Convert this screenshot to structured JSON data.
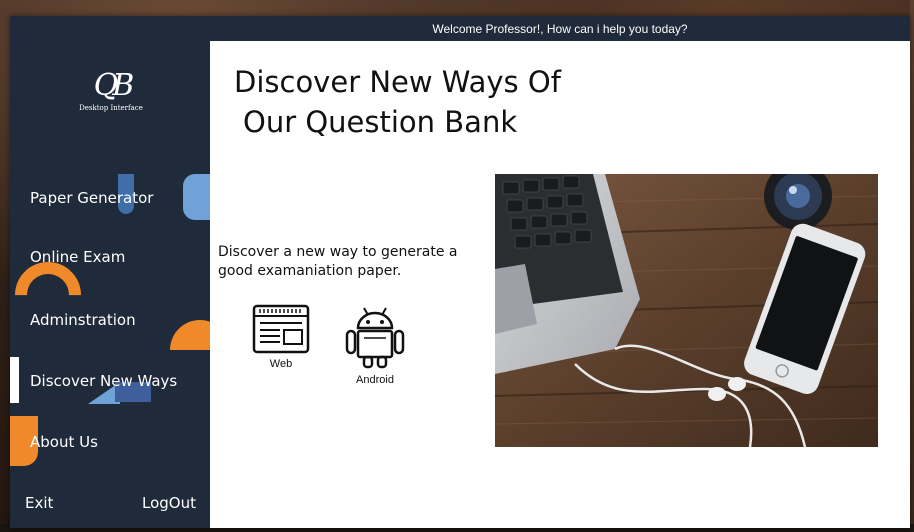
{
  "window": {
    "title": "Welcome Professor!, How can i help you today?"
  },
  "logo": {
    "mark": "QB",
    "subtitle": "Desktop Interface"
  },
  "sidebar": {
    "items": [
      {
        "label": "Paper Generator"
      },
      {
        "label": "Online Exam"
      },
      {
        "label": "Adminstration"
      },
      {
        "label": "Discover New Ways"
      },
      {
        "label": "About Us"
      }
    ],
    "active_index": 3,
    "exit_label": "Exit",
    "logout_label": "LogOut"
  },
  "main": {
    "heading_line1": "Discover New Ways Of",
    "heading_line2": "Our Question Bank",
    "description": "Discover a new way to generate a good examaniation paper.",
    "platforms": [
      {
        "label": "Web",
        "icon": "web-browser-icon"
      },
      {
        "label": "Android",
        "icon": "android-icon"
      }
    ],
    "hero_image": "laptop-and-phone-on-wooden-desk"
  },
  "colors": {
    "sidebar_bg": "#1f2a3a",
    "accent_orange": "#f0892a",
    "accent_blue": "#6fa3d8",
    "text_dark": "#111111"
  }
}
